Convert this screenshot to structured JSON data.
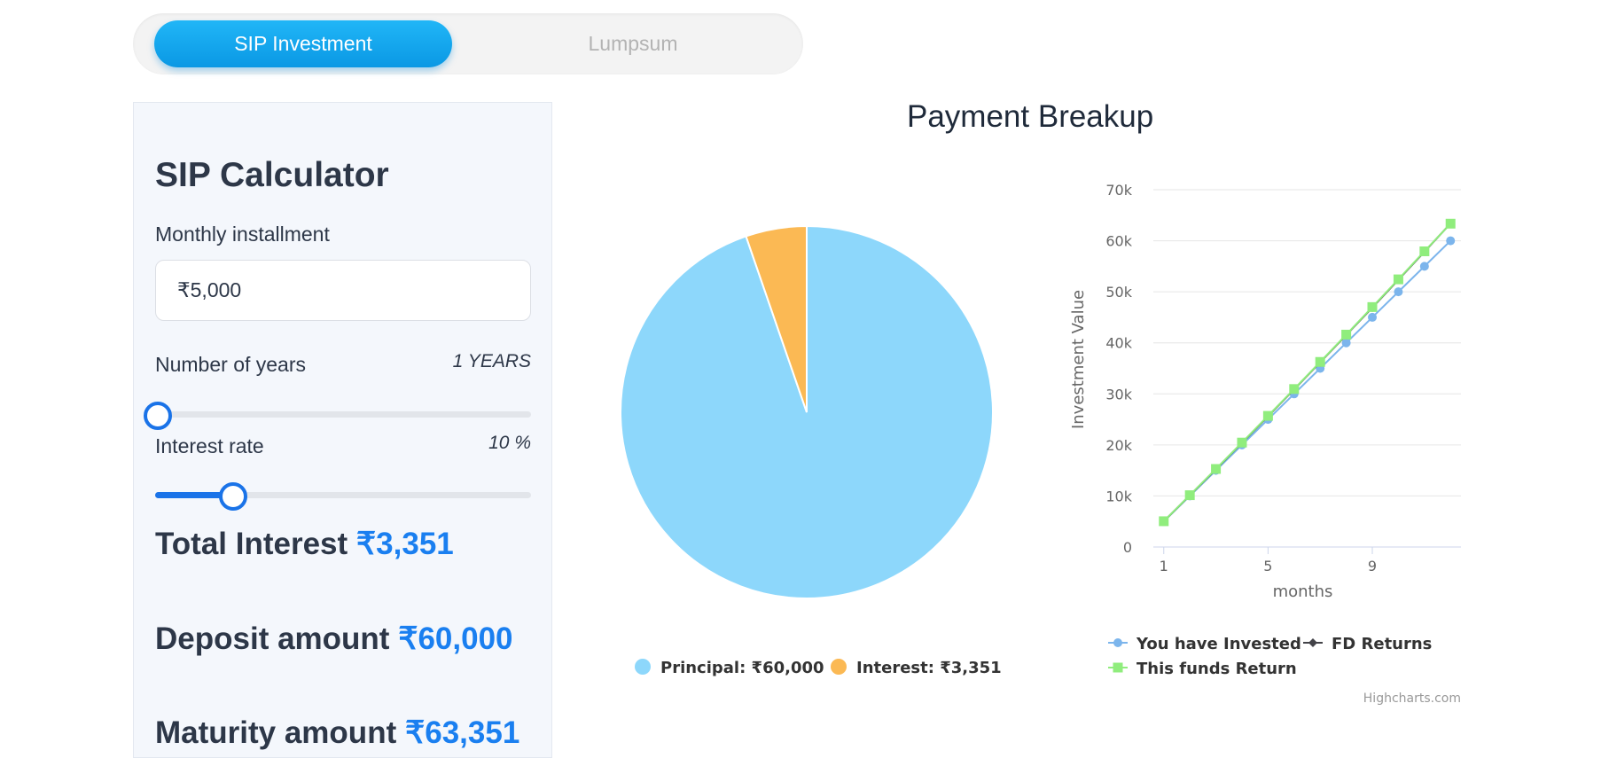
{
  "tabs": {
    "sip": "SIP Investment",
    "lumpsum": "Lumpsum"
  },
  "calculator": {
    "title": "SIP Calculator",
    "monthly_label": "Monthly installment",
    "monthly_value": "₹5,000",
    "years_label": "Number of years",
    "years_value": "1 YEARS",
    "years_slider": 0.0,
    "rate_label": "Interest rate",
    "rate_value": "10 %",
    "rate_slider": 0.2,
    "total_interest_label": "Total Interest",
    "total_interest_value": "₹3,351",
    "deposit_label": "Deposit amount",
    "deposit_value": "₹60,000",
    "maturity_label": "Maturity amount",
    "maturity_value": "₹63,351"
  },
  "colors": {
    "accent": "#1a7ff0",
    "principal": "#8dd7fb",
    "interest": "#fbb954",
    "invested": "#7cb5ec",
    "fd": "#434348",
    "fund": "#90ed7d"
  },
  "chart_data": [
    {
      "type": "pie",
      "title": "Payment Breakup",
      "slices": [
        {
          "name": "Principal",
          "value": 60000,
          "label": "Principal: ₹60,000"
        },
        {
          "name": "Interest",
          "value": 3351,
          "label": "Interest: ₹3,351"
        }
      ],
      "legend": "bottom"
    },
    {
      "type": "line",
      "xlabel": "months",
      "ylabel": "Investment Value",
      "x": [
        1,
        2,
        3,
        4,
        5,
        6,
        7,
        8,
        9,
        10,
        11,
        12
      ],
      "x_ticks": [
        "1",
        "5",
        "9"
      ],
      "y_ticks": [
        "0",
        "10k",
        "20k",
        "30k",
        "40k",
        "50k",
        "60k",
        "70k"
      ],
      "ylim": [
        0,
        70000
      ],
      "series": [
        {
          "name": "You have Invested",
          "values": [
            5000,
            10000,
            15000,
            20000,
            25000,
            30000,
            35000,
            40000,
            45000,
            50000,
            55000,
            60000
          ]
        },
        {
          "name": "FD Returns",
          "values": [
            5040,
            10120,
            15240,
            20410,
            25620,
            30880,
            36180,
            41530,
            46920,
            52360,
            57850,
            63380
          ]
        },
        {
          "name": "This funds Return",
          "values": [
            5050,
            10150,
            15290,
            20460,
            25690,
            30950,
            36260,
            41610,
            47010,
            52440,
            57930,
            63350
          ]
        }
      ],
      "legend": "bottom",
      "credit": "Highcharts.com",
      "grid": true
    }
  ]
}
